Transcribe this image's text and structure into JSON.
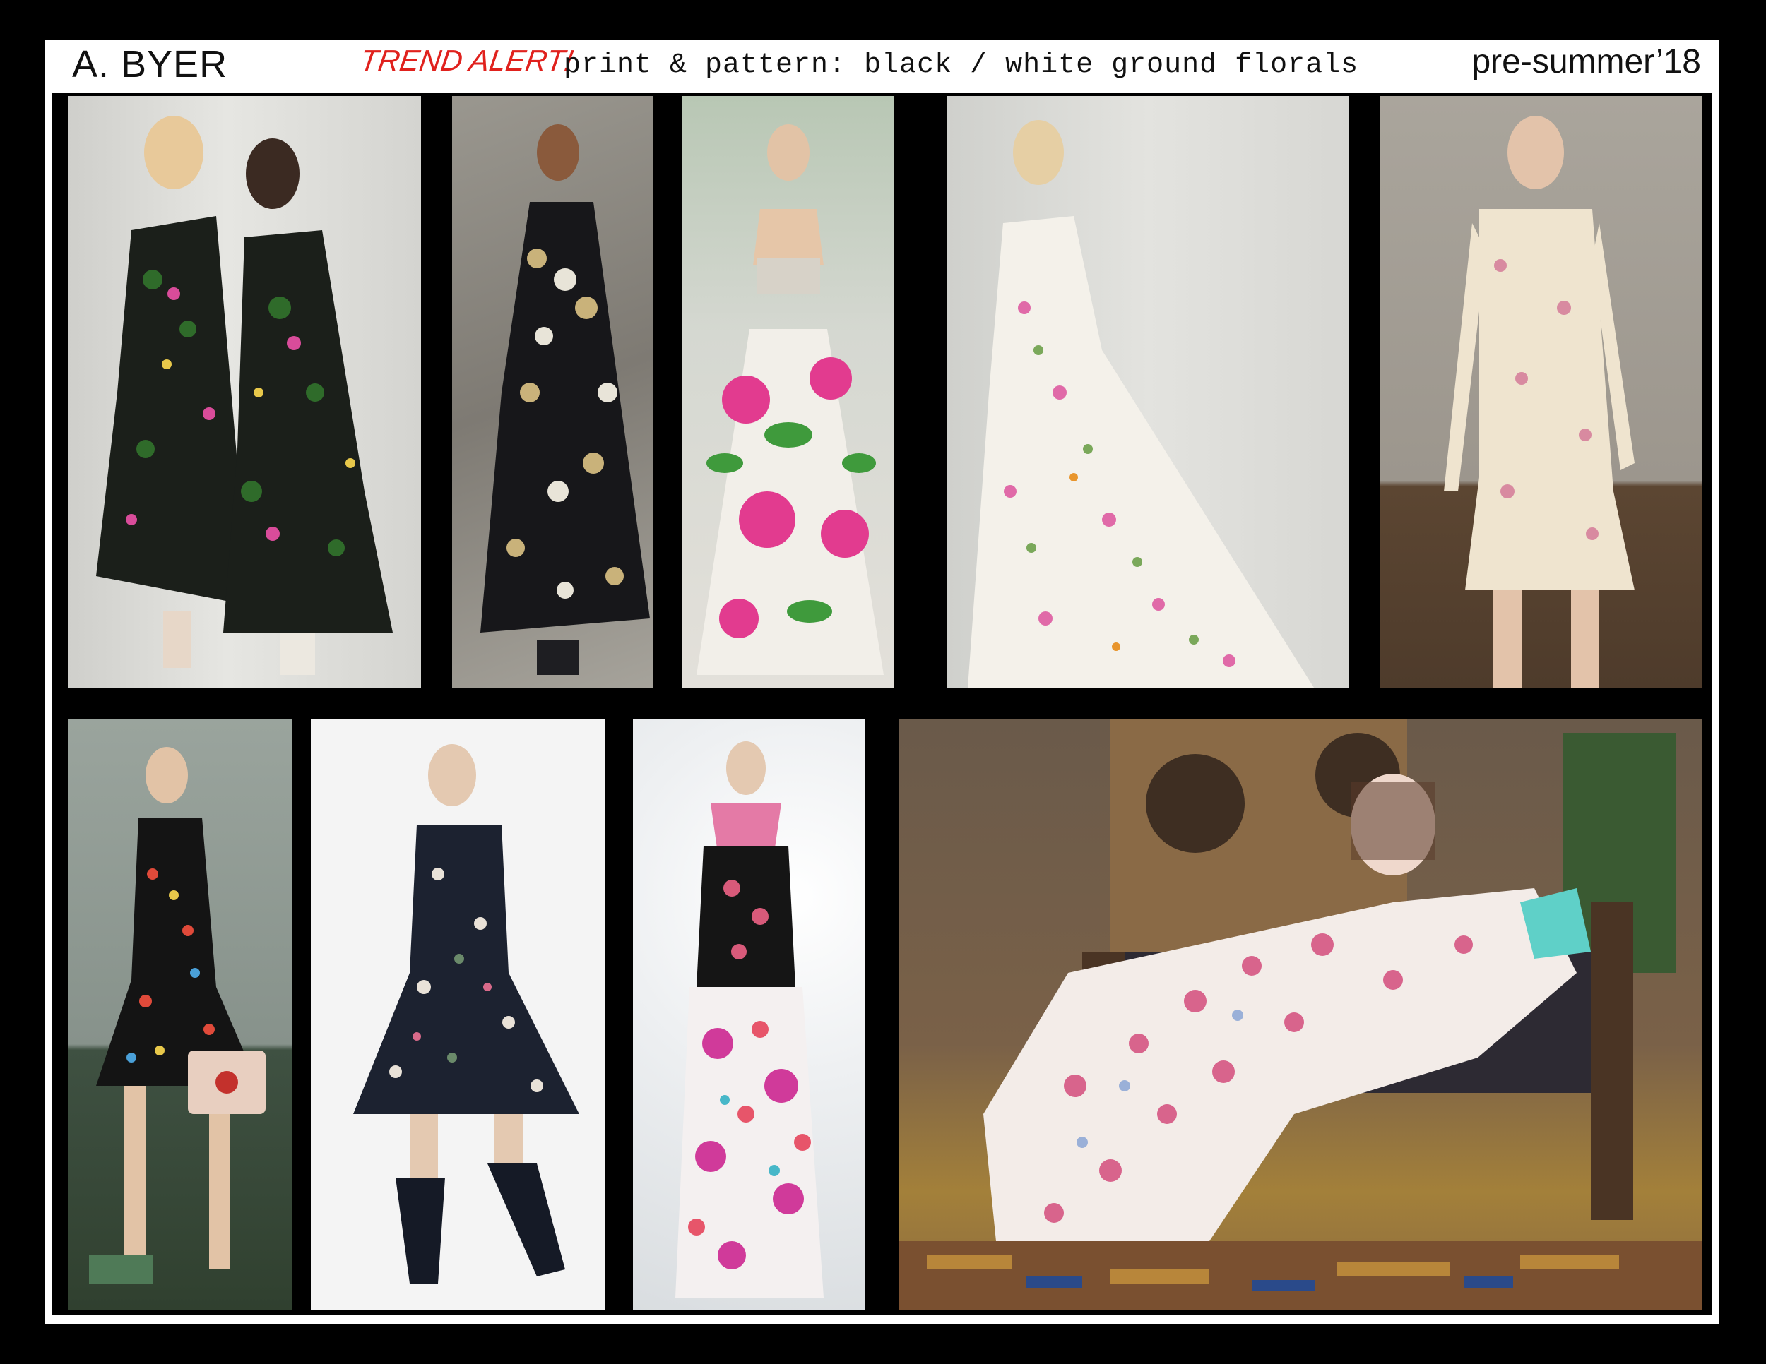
{
  "header": {
    "brand": "A. BYER",
    "alert": "TREND ALERT!",
    "topic": "print & pattern: black / white ground florals",
    "season": "pre-summer’18"
  },
  "colors": {
    "board_background": "#000000",
    "header_background": "#ffffff",
    "alert_text": "#e0211d",
    "body_text": "#111111"
  },
  "photos": [
    {
      "id": "photo-1",
      "subject": "two models in black ground botanical floral dresses",
      "palette": [
        "#d9d9d6",
        "#1b1f1a",
        "#2f6b2a",
        "#d94c9a"
      ]
    },
    {
      "id": "photo-2",
      "subject": "model in black ruffled passionflower print gown",
      "palette": [
        "#8d8a83",
        "#17171a",
        "#c9b27a",
        "#e8e4d8"
      ]
    },
    {
      "id": "photo-3",
      "subject": "runway model in embellished bra top and white skirt with pink roses",
      "palette": [
        "#c8cfc6",
        "#f2efe9",
        "#e23b8f",
        "#3f9a3c"
      ]
    },
    {
      "id": "photo-4",
      "subject": "model in white ground wildflower gown",
      "palette": [
        "#d6d6d2",
        "#f4f1ea",
        "#e06aa8",
        "#7aa85a"
      ]
    },
    {
      "id": "photo-5",
      "subject": "model in ivory rose print tie-neck dress",
      "palette": [
        "#a9a39a",
        "#efe4cf",
        "#d88aa0",
        "#5c4632"
      ]
    },
    {
      "id": "photo-6",
      "subject": "model in black one-shoulder floral dress with blush handbag",
      "palette": [
        "#8f9a93",
        "#141414",
        "#e04a3a",
        "#e8cfc0"
      ]
    },
    {
      "id": "photo-7",
      "subject": "model in black floral midi dress and black boots",
      "palette": [
        "#f4f4f4",
        "#1c2230",
        "#e9e2d8",
        "#6a8a6a"
      ]
    },
    {
      "id": "photo-8",
      "subject": "model in black floral top, scarf and white wide pants with magenta florals",
      "palette": [
        "#eef0f2",
        "#151515",
        "#d03a9a",
        "#e7556a"
      ]
    },
    {
      "id": "photo-9",
      "subject": "model reclining on cane settee in white ground pink floral gown",
      "palette": [
        "#7a6148",
        "#f3ece8",
        "#d8648c",
        "#2d2a33"
      ]
    }
  ]
}
